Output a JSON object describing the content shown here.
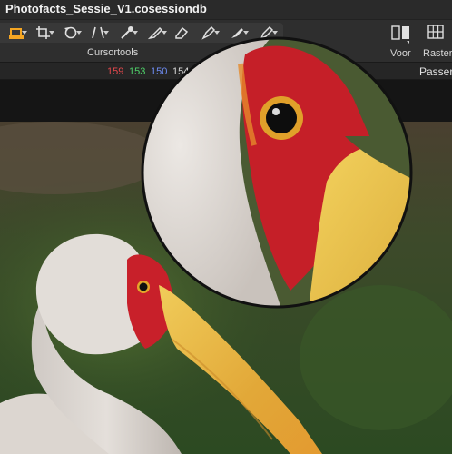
{
  "window": {
    "title": "Photofacts_Sessie_V1.cosessiondb"
  },
  "toolbar": {
    "tools": [
      {
        "name": "crop-tool-icon",
        "active": true
      },
      {
        "name": "crop-icon"
      },
      {
        "name": "rotate-icon"
      },
      {
        "name": "keystone-icon"
      },
      {
        "name": "pipette-icon"
      },
      {
        "name": "brush-icon"
      },
      {
        "name": "eraser-icon"
      },
      {
        "name": "pen-icon"
      },
      {
        "name": "gradient-brush-icon"
      },
      {
        "name": "color-picker-icon"
      }
    ],
    "group_label": "Cursortools",
    "voor_label": "Voor",
    "raster_label": "Raster"
  },
  "infobar": {
    "r": "159",
    "g": "153",
    "b": "150",
    "k": "154",
    "mode_label": "Passer",
    "colors": {
      "r": "#e5484d",
      "g": "#4fd16a",
      "b": "#6f8df5",
      "k": "#d8d8d8"
    }
  },
  "colors": {
    "accent": "#f5a623",
    "beak": "#e8c04a",
    "face": "#c8202a",
    "feather": "#dcd6d0"
  }
}
